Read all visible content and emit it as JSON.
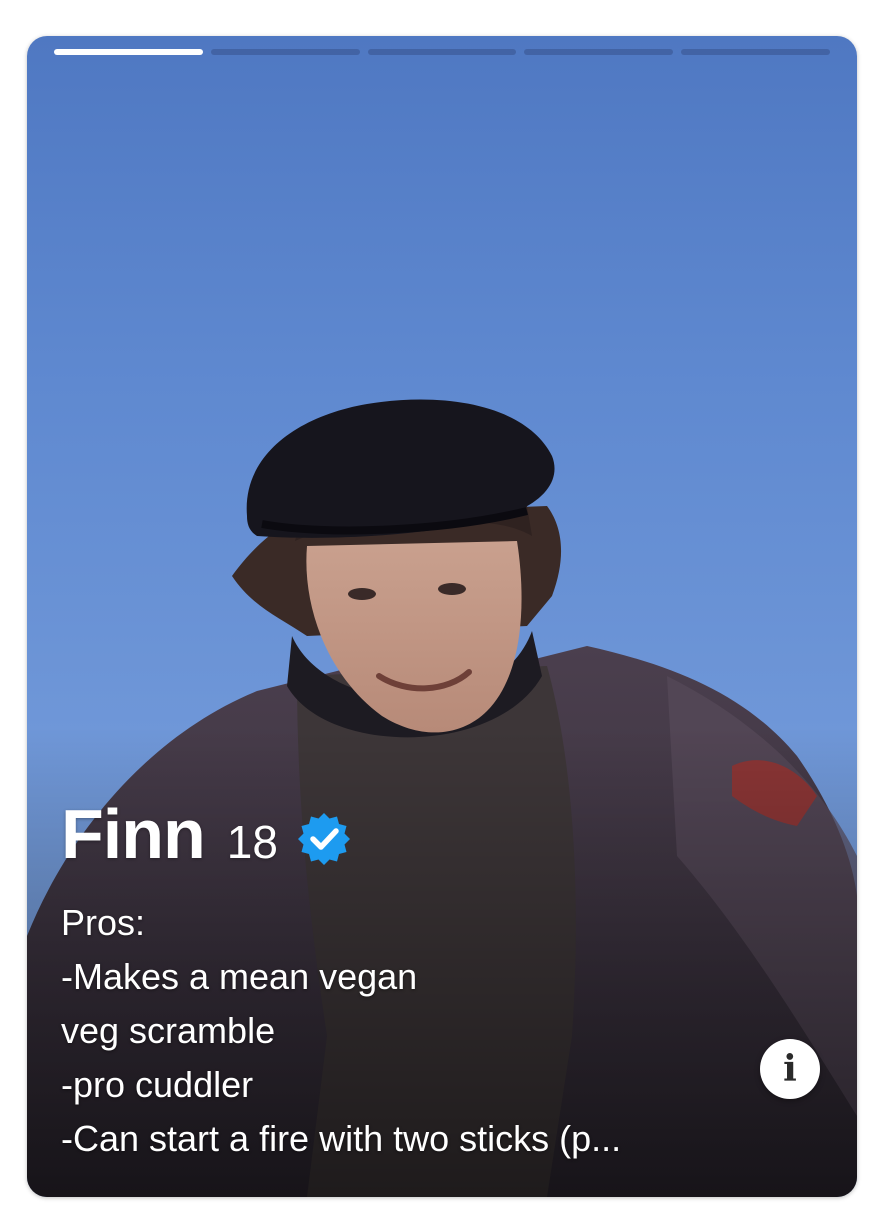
{
  "profile": {
    "name": "Finn",
    "age": "18",
    "verified_icon": "verified-badge-icon",
    "bio": {
      "line1": "Pros:",
      "line2": "-Makes a mean vegan",
      "line3": "veg scramble",
      "line4": "-pro cuddler",
      "line5": "-Can start a fire with two sticks (p..."
    }
  },
  "photos": {
    "count": 5,
    "active_index": 0
  },
  "info_button": {
    "icon": "info-icon",
    "label": "i"
  },
  "colors": {
    "verified_blue": "#1d9bf0",
    "sky_top": "#4f78c2",
    "sky_bottom": "#7da3dc"
  }
}
